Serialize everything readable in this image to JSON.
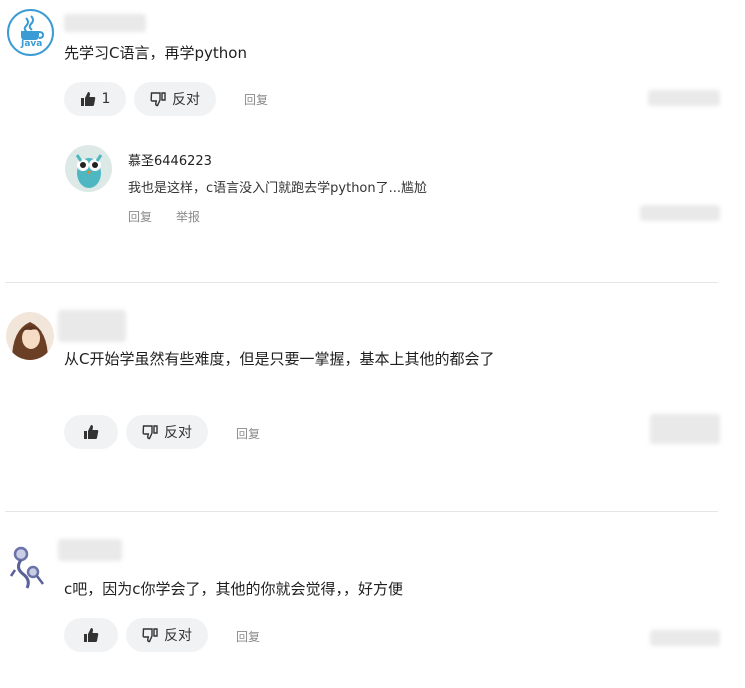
{
  "comments": [
    {
      "text": "先学习C语言，再学python",
      "like_count": "1",
      "dislike_label": "反对",
      "reply_label": "回复"
    },
    {
      "text": "从C开始学虽然有些难度，但是只要一掌握，基本上其他的都会了",
      "dislike_label": "反对",
      "reply_label": "回复"
    },
    {
      "text": "c吧，因为c你学会了，其他的你就会觉得，，好方便",
      "dislike_label": "反对",
      "reply_label": "回复"
    }
  ],
  "reply": {
    "username": "慕圣6446223",
    "text": "我也是这样，c语言没入门就跑去学python了...尴尬",
    "reply_label": "回复",
    "report_label": "举报"
  },
  "avatar_labels": {
    "java": "Java"
  },
  "colors": {
    "pill_bg": "#f1f2f3",
    "java_blue": "#3a9bd5",
    "divider": "#e6e6e6"
  },
  "icons": [
    "java-logo-icon",
    "thumbs-up-icon",
    "thumbs-down-icon"
  ]
}
